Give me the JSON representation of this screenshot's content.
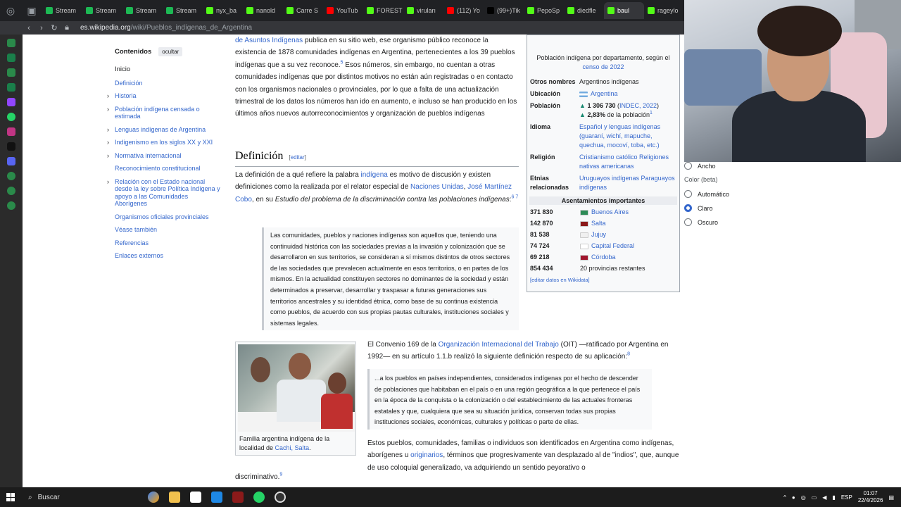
{
  "browser": {
    "tabs": [
      {
        "label": "Stream",
        "color": "#1db954"
      },
      {
        "label": "Stream",
        "color": "#1db954"
      },
      {
        "label": "Stream",
        "color": "#1db954"
      },
      {
        "label": "Stream",
        "color": "#1db954"
      },
      {
        "label": "nyx_ba",
        "color": "#53fc18"
      },
      {
        "label": "nanold",
        "color": "#53fc18"
      },
      {
        "label": "Carre S",
        "color": "#53fc18"
      },
      {
        "label": "YouTub",
        "color": "#ff0000"
      },
      {
        "label": "FOREST",
        "color": "#53fc18"
      },
      {
        "label": "viruları",
        "color": "#53fc18"
      },
      {
        "label": "(112) Yo",
        "color": "#ff0000"
      },
      {
        "label": "(99+)Tik",
        "color": "#000000"
      },
      {
        "label": "PepoSp",
        "color": "#53fc18"
      },
      {
        "label": "diedfle",
        "color": "#53fc18"
      },
      {
        "label": "baul",
        "color": "#53fc18"
      },
      {
        "label": "rageylo",
        "color": "#53fc18"
      }
    ],
    "url_domain": "es.wikipedia.org",
    "url_path": "/wiki/Pueblos_indígenas_de_Argentina"
  },
  "toc": {
    "title": "Contenidos",
    "hide_label": "ocultar",
    "items": [
      {
        "label": "Inicio",
        "expandable": false
      },
      {
        "label": "Definición",
        "expandable": false
      },
      {
        "label": "Historia",
        "expandable": true
      },
      {
        "label": "Población indígena censada o estimada",
        "expandable": true
      },
      {
        "label": "Lenguas indígenas de Argentina",
        "expandable": true
      },
      {
        "label": "Indigenismo en los siglos XX y XXI",
        "expandable": true
      },
      {
        "label": "Normativa internacional",
        "expandable": true
      },
      {
        "label": "Reconocimiento constitucional",
        "expandable": false
      },
      {
        "label": "Relación con el Estado nacional desde la ley sobre Política Indígena y apoyo a las Comunidades Aborígenes",
        "expandable": true
      },
      {
        "label": "Organismos oficiales provinciales",
        "expandable": false
      },
      {
        "label": "Véase también",
        "expandable": false
      },
      {
        "label": "Referencias",
        "expandable": false
      },
      {
        "label": "Enlaces externos",
        "expandable": false
      }
    ]
  },
  "article": {
    "intro_link": "de Asuntos Indígenas",
    "intro_text": " publica en su sitio web, ese organismo público reconoce la existencia de 1878 comunidades indígenas en Argentina, pertenecientes a los 39 pueblos indígenas que a su vez reconoce.",
    "intro_sup": "5",
    "intro_text2": " Esos números, sin embargo, no cuentan a otras comunidades indígenas que por distintos motivos no están aún registradas o en contacto con los organismos nacionales o provinciales, por lo que a falta de una actualización trimestral de los datos los números han ido en aumento, e incluso se han producido en los últimos años nuevos autorreconocimientos y organización de pueblos indígenas",
    "section_title": "Definición",
    "edit_label": "editar",
    "def_text1": "La definición de a qué refiere la palabra ",
    "def_link1": "indígena",
    "def_text2": " es motivo de discusión y existen definiciones como la realizada por el relator especial de ",
    "def_link2": "Naciones Unidas",
    "def_text3": ", ",
    "def_link3": "José Martínez Cobo",
    "def_text4": ", en su ",
    "def_italic": "Estudio del problema de la discriminación contra las poblaciones indígenas",
    "def_sup": "6 7",
    "quote1": "Las comunidades, pueblos y naciones indígenas son aquellos que, teniendo una continuidad histórica con las sociedades previas a la invasión y colonización que se desarrollaron en sus territorios, se consideran a sí mismos distintos de otros sectores de las sociedades que prevalecen actualmente en esos territorios, o en partes de los mismos. En la actualidad constituyen sectores no dominantes de la sociedad y están determinados a preservar, desarrollar y traspasar a futuras generaciones sus territorios ancestrales y su identidad étnica, como base de su continua existencia como pueblos, de acuerdo con sus propias pautas culturales, instituciones sociales y sistemas legales.",
    "figure_caption1": "Familia argentina indígena de la localidad de ",
    "figure_caption_link": "Cachi, Salta",
    "figure_caption2": ".",
    "convenio_text1": "El Convenio 169 de la ",
    "convenio_link": "Organización Internacional del Trabajo",
    "convenio_text2": " (OIT) —ratificado por Argentina en 1992— en su artículo 1.1.b realizó la siguiente definición respecto de su aplicación:",
    "convenio_sup": "8",
    "quote2": "...a los pueblos en países independientes, considerados indígenas por el hecho de descender de poblaciones que habitaban en el país o en una región geográfica a la que pertenece el país en la época de la conquista o la colonización o del establecimiento de las actuales fronteras estatales y que, cualquiera que sea su situación jurídica, conservan todas sus propias instituciones sociales, económicas, culturales y políticas o parte de ellas.",
    "after_text1": "Estos pueblos, comunidades, familias o individuos son identificados en Argentina como indígenas, aborígenes u ",
    "after_link": "originarios",
    "after_text2": ", términos que progresivamente van desplazado al de \"indios\", que, aunque de uso coloquial generalizado, va adquiriendo un sentido peyorativo o",
    "last_text": "discriminativo.",
    "last_sup": "9"
  },
  "infobox": {
    "caption_text": "Población indígena por departamento, según el ",
    "caption_link": "censo de 2022",
    "rows": [
      {
        "label": "Otros nombres",
        "value": "Argentinos indígenas"
      },
      {
        "label": "Ubicación",
        "value": "Argentina"
      },
      {
        "label": "Población",
        "value_bold": "1 306 730",
        "value_link": "INDEC, 2022",
        "value2_bold": "2,83%",
        "value2": " de la población",
        "value2_sup": "1"
      },
      {
        "label": "Idioma",
        "value": "Español y lenguas indígenas (guaraní, wichí, mapuche, quechua, mocoví, toba, etc.)"
      },
      {
        "label": "Religión",
        "value": "Cristianismo católico Religiones nativas americanas"
      },
      {
        "label": "Etnias relacionadas",
        "value": "Uruguayos indígenas Paraguayos indígenas"
      }
    ],
    "settlements_title": "Asentamientos importantes",
    "settlements": [
      {
        "count": "371 830",
        "place": "Buenos Aires",
        "flag": "#2e8b57",
        "link": true
      },
      {
        "count": "142 870",
        "place": "Salta",
        "flag": "#8b1a1a",
        "link": true
      },
      {
        "count": "81 538",
        "place": "Jujuy",
        "flag": "#f0f0f0",
        "link": true
      },
      {
        "count": "74 724",
        "place": "Capital Federal",
        "flag": "#ffffff",
        "link": true
      },
      {
        "count": "69 218",
        "place": "Córdoba",
        "flag": "#a0152d",
        "link": true
      },
      {
        "count": "854 434",
        "place": "20 provincias restantes",
        "flag": "",
        "link": false
      }
    ],
    "wikidata_label": "[editar datos en Wikidata]"
  },
  "appearance": {
    "width_option": "Ancho",
    "color_label": "Color (beta)",
    "options": [
      "Automático",
      "Claro",
      "Oscuro"
    ],
    "selected": "Claro"
  },
  "taskbar": {
    "search_label": "Buscar",
    "lang": "ESP",
    "time": "01:07",
    "date": "22/4/2026"
  }
}
